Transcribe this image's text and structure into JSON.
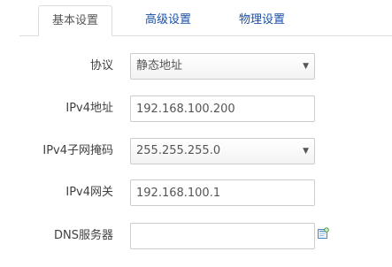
{
  "tabs": [
    {
      "label": "基本设置",
      "active": true
    },
    {
      "label": "高级设置",
      "active": false
    },
    {
      "label": "物理设置",
      "active": false
    }
  ],
  "form": {
    "protocol": {
      "label": "协议",
      "value": "静态地址"
    },
    "ipv4_address": {
      "label": "IPv4地址",
      "value": "192.168.100.200"
    },
    "ipv4_netmask": {
      "label": "IPv4子网掩码",
      "value": "255.255.255.0"
    },
    "ipv4_gateway": {
      "label": "IPv4网关",
      "value": "192.168.100.1"
    },
    "dns_server": {
      "label": "DNS服务器",
      "value": ""
    }
  },
  "icons": {
    "caret": "dropdown-caret-icon",
    "add": "add-entry-icon"
  },
  "colors": {
    "link": "#1a4fa8",
    "border": "#cccccc",
    "add_icon_green": "#5aa64a",
    "add_icon_blue": "#4a86c8"
  }
}
